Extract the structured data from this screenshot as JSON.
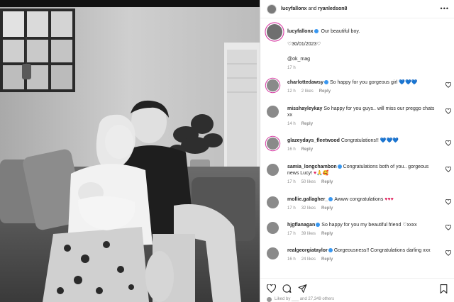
{
  "header": {
    "username": "lucyfallonx",
    "connector": "and",
    "collaborator": "ryanledson8",
    "more_label": "•••"
  },
  "caption": {
    "username": "lucyfallonx",
    "text": "Our beautiful boy.",
    "date_line": "♡30/01/2023♡",
    "tag": "@ok_mag",
    "time": "17 h"
  },
  "comments": [
    {
      "username": "charlottedawsy",
      "verified": true,
      "ring": true,
      "text": "So happy for you gorgeous girl",
      "emoji": "💙💙💙",
      "emoji_color": "blue",
      "time": "12 h",
      "likes": "2 likes",
      "reply": "Reply"
    },
    {
      "username": "misshayleykay",
      "verified": false,
      "ring": false,
      "text": "So happy for you guys.. will miss our preggo chats xx",
      "emoji": "",
      "emoji_color": "",
      "time": "14 h",
      "likes": "",
      "reply": "Reply"
    },
    {
      "username": "glazeydays_fleetwood",
      "verified": false,
      "ring": true,
      "text": "Congratulations!!",
      "emoji": "💙💙💙",
      "emoji_color": "blue",
      "time": "16 h",
      "likes": "",
      "reply": "Reply"
    },
    {
      "username": "samia_longchambon",
      "verified": true,
      "ring": false,
      "text": "Congratulations both of you.. gorgeous news Lucy!",
      "emoji": "♥🙏🥰",
      "emoji_color": "red",
      "time": "17 h",
      "likes": "50 likes",
      "reply": "Reply"
    },
    {
      "username": "mollie.gallagher_",
      "verified": true,
      "ring": false,
      "text": "Awww congratulations",
      "emoji": "♥♥♥",
      "emoji_color": "red",
      "time": "17 h",
      "likes": "32 likes",
      "reply": "Reply"
    },
    {
      "username": "hjgflanagan",
      "verified": true,
      "ring": false,
      "text": "So happy for you my beautiful friend",
      "emoji": "♡xxxx",
      "emoji_color": "",
      "time": "17 h",
      "likes": "39 likes",
      "reply": "Reply"
    },
    {
      "username": "realgeorgiataylor",
      "verified": true,
      "ring": false,
      "text": "Gorgeousness!! Congratulations darling xxx",
      "emoji": "",
      "emoji_color": "",
      "time": "16 h",
      "likes": "24 likes",
      "reply": "Reply"
    }
  ],
  "footer": {
    "likes_text": "Liked by ___ and 27,349 others"
  },
  "colors": {
    "verified": "#3897f0",
    "story_ring": "#d63ca3",
    "muted_text": "#8e8e8e",
    "primary_text": "#262626"
  }
}
